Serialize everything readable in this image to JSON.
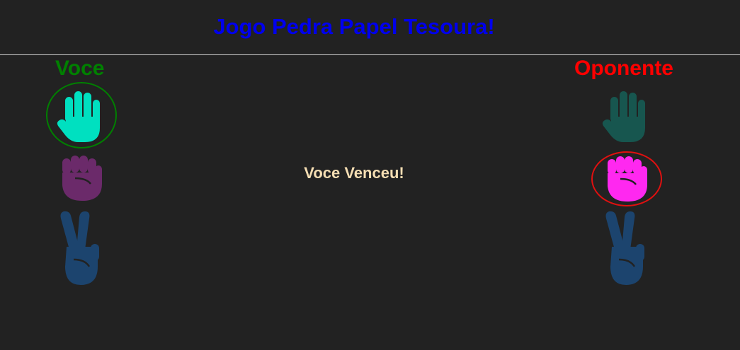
{
  "header": {
    "title": "Jogo Pedra Papel Tesoura!"
  },
  "players": {
    "you_label": "Voce",
    "opponent_label": "Oponente"
  },
  "result": {
    "text": "Voce Venceu!"
  },
  "choices": {
    "you": [
      {
        "name": "paper",
        "icon": "hand-paper-icon",
        "color": "#00e0c0",
        "selected": true
      },
      {
        "name": "rock",
        "icon": "hand-rock-icon",
        "color": "#6b2a6a",
        "selected": false
      },
      {
        "name": "scissors",
        "icon": "hand-scissors-icon",
        "color": "#1c446e",
        "selected": false
      }
    ],
    "opponent": [
      {
        "name": "paper",
        "icon": "hand-paper-icon",
        "color": "#17564f",
        "selected": false
      },
      {
        "name": "rock",
        "icon": "hand-rock-icon",
        "color": "#ff28f0",
        "selected": true
      },
      {
        "name": "scissors",
        "icon": "hand-scissors-icon",
        "color": "#1c446e",
        "selected": false
      }
    ]
  },
  "colors": {
    "background": "#222222",
    "title": "#0000ee",
    "you": "#008000",
    "opponent": "#ff0000",
    "result": "#f5deb3"
  }
}
